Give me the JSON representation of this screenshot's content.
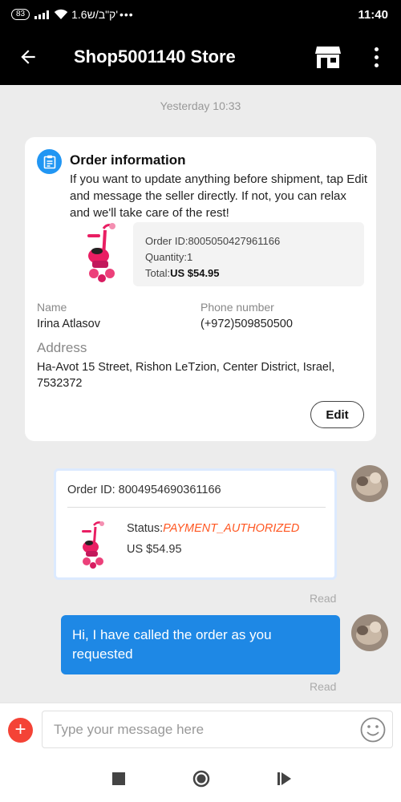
{
  "status_bar": {
    "battery": "83",
    "network_text": "1.6ק\"ב/ש'",
    "dots": "•••",
    "time": "11:40"
  },
  "app_bar": {
    "title": "Shop5001140 Store",
    "back_icon": "arrow-left-icon",
    "store_icon": "store-icon",
    "more_icon": "more-vert-icon"
  },
  "timestamp": "Yesterday 10:33",
  "order_card": {
    "title": "Order information",
    "description": "If you want to update anything before shipment, tap Edit and message the seller directly. If not, you can relax and we'll take care of the rest!",
    "order_id": "Order ID:8005050427961166",
    "quantity": "Quantity:1",
    "total_label": "Total:",
    "total_value": "US $54.95",
    "name_label": "Name",
    "name_value": "Irina Atlasov",
    "phone_label": "Phone number",
    "phone_value": "(+972)509850500",
    "address_label": "Address",
    "address_value": "Ha-Avot 15 Street, Rishon LeTzion, Center District, Israel, 7532372",
    "edit_label": "Edit"
  },
  "order_message": {
    "order_id": "Order ID: 8004954690361166",
    "status_label": "Status:",
    "status_value": "PAYMENT_AUTHORIZED",
    "price": "US $54.95",
    "read": "Read"
  },
  "text_message": {
    "text": "Hi, I have called the order as you requested",
    "read": "Read"
  },
  "input_bar": {
    "placeholder": "Type your message here",
    "plus_icon": "plus-icon",
    "emoji_icon": "emoji-icon"
  },
  "colors": {
    "accent_blue": "#1e88e5",
    "status_orange": "#ff5722",
    "plus_red": "#f44336"
  }
}
